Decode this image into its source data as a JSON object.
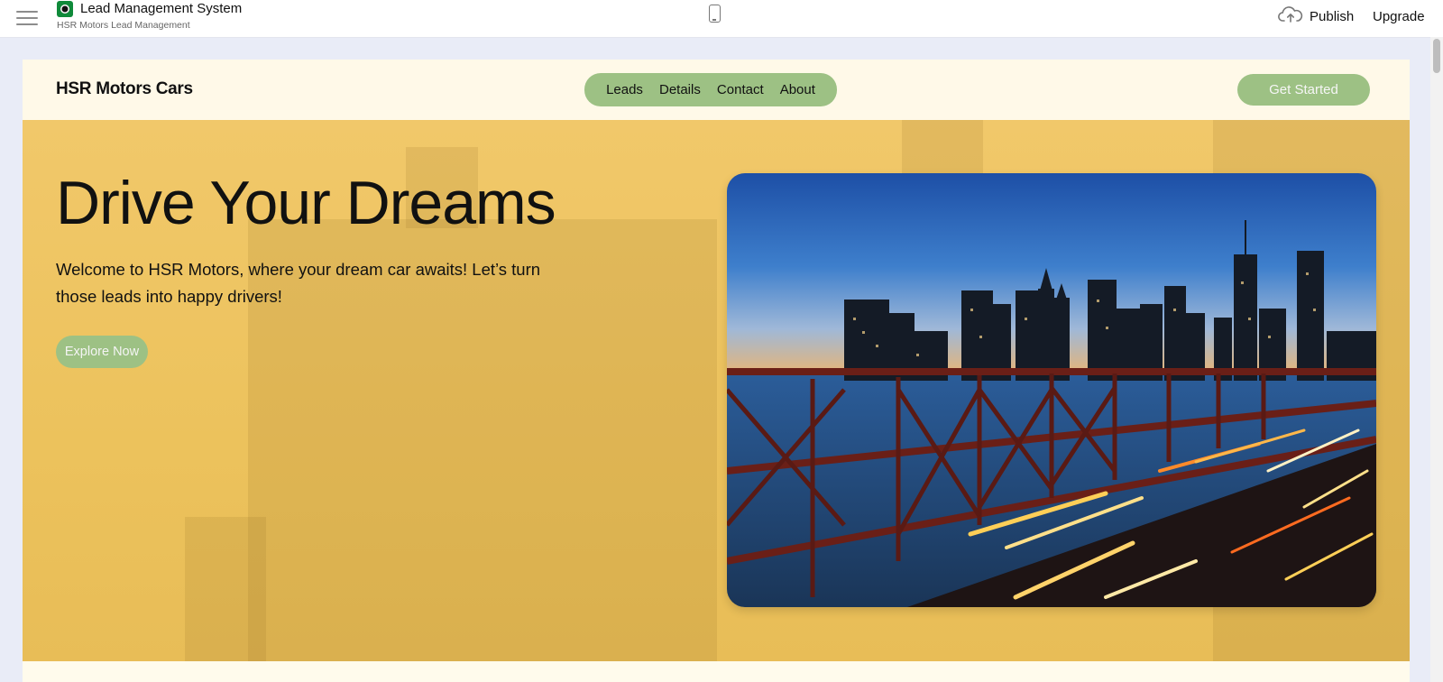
{
  "app": {
    "title": "Lead Management System",
    "subtitle": "HSR Motors Lead Management",
    "publish_label": "Publish",
    "upgrade_label": "Upgrade",
    "icons": [
      "menu-icon",
      "app-logo-icon",
      "mobile-device-icon",
      "cloud-upload-icon"
    ]
  },
  "site": {
    "brand": "HSR Motors Cars",
    "nav": [
      "Leads",
      "Details",
      "Contact",
      "About"
    ],
    "cta_label": "Get Started",
    "accent_color": "#9dc184",
    "hero_color": "#f1c86a",
    "hero": {
      "title": "Drive Your Dreams",
      "text": "Welcome to HSR Motors, where your dream car awaits! Let’s turn those leads into happy drivers!",
      "button_label": "Explore Now"
    }
  }
}
